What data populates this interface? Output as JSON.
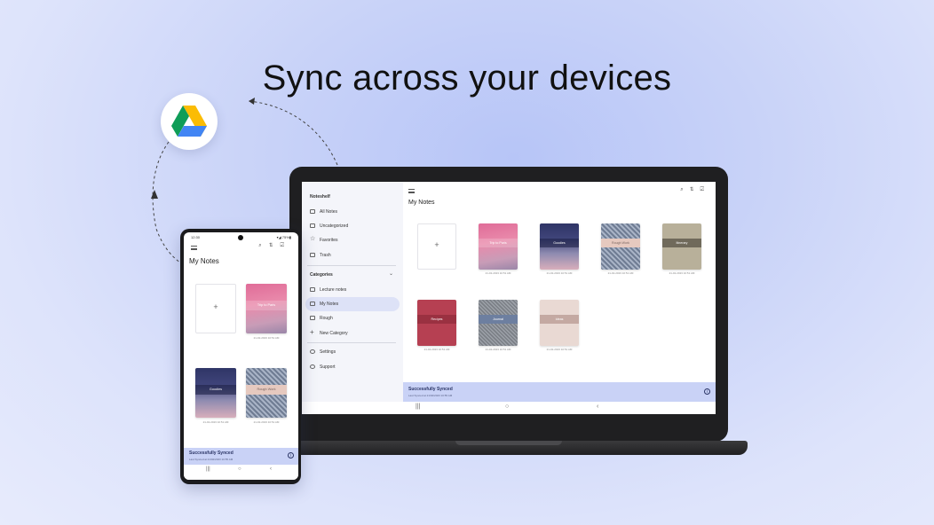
{
  "headline": "Sync across your devices",
  "drive_badge": {
    "icon": "google-drive-icon"
  },
  "laptop": {
    "sidebar": {
      "brand": "Noteshelf",
      "items": [
        {
          "label": "All Notes",
          "icon": "book-icon"
        },
        {
          "label": "Uncategorized",
          "icon": "folder-icon"
        },
        {
          "label": "Favorites",
          "icon": "star-icon"
        },
        {
          "label": "Trash",
          "icon": "trash-icon"
        }
      ],
      "categories_label": "Categories",
      "categories": [
        {
          "label": "Lecture notes",
          "icon": "folder-icon"
        },
        {
          "label": "My Notes",
          "icon": "folder-icon",
          "active": true
        },
        {
          "label": "Rough",
          "icon": "folder-icon"
        },
        {
          "label": "New Category",
          "icon": "plus-icon"
        }
      ],
      "footer": [
        {
          "label": "Settings",
          "icon": "gear-icon"
        },
        {
          "label": "Support",
          "icon": "help-icon"
        }
      ]
    },
    "main": {
      "title": "My Notes",
      "top_icons": [
        "search-icon",
        "sort-icon",
        "select-icon"
      ],
      "notebooks": [
        {
          "title": "Trip to Paris",
          "date": "21-02-2023 10:51 AM"
        },
        {
          "title": "Goodies",
          "date": "21-02-2023 10:51 AM"
        },
        {
          "title": "Rough Work",
          "date": "21-02-2023 10:51 AM"
        },
        {
          "title": "Itinerary",
          "date": "21-02-2023 10:51 AM"
        },
        {
          "title": "Recipes",
          "date": "21-02-2023 10:51 AM"
        },
        {
          "title": "Journal",
          "date": "21-02-2023 10:51 AM"
        },
        {
          "title": "Ideas",
          "date": "21-02-2023 10:51 AM"
        }
      ],
      "synced_title": "Successfully Synced",
      "synced_sub": "Last Synced at 21/02/2023 10:55 AM"
    }
  },
  "phone": {
    "status_time": "12:30",
    "status_right": "▾◢ 75%▮",
    "title": "My Notes",
    "notebooks": [
      {
        "title": "Trip to Paris",
        "date": "21-02-2023 10:51 AM"
      },
      {
        "title": "Goodies",
        "date": "21-02-2023 10:51 AM"
      },
      {
        "title": "Rough Work",
        "date": "21-02-2023 10:51 AM"
      }
    ],
    "synced_title": "Successfully Synced",
    "synced_sub": "Last Synced at 21/02/2023 10:55 AM"
  },
  "nav_buttons": [
    "|||",
    "○",
    "‹"
  ]
}
